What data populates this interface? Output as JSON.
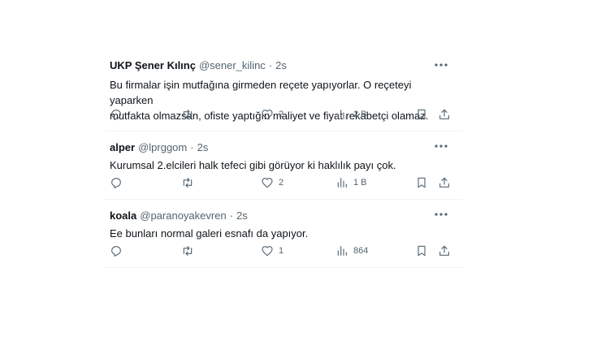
{
  "tweets": [
    {
      "author": "UKP Şener Kılınç",
      "handle": "@sener_kilinc",
      "separator": "·",
      "time": "2s",
      "lines": [
        "Bu firmalar işin mutfağına girmeden reçete yapıyorlar. O reçeteyi yaparken",
        "mutfakta olmazsan, ofiste yaptığın maliyet ve fiyat rekabetçi olamaz."
      ],
      "replies": "",
      "retweets": "",
      "likes": "2",
      "views": "2 B"
    },
    {
      "author": "alper",
      "handle": "@lprggom",
      "separator": "·",
      "time": "2s",
      "lines": [
        "Kurumsal 2.elcileri halk tefeci gibi görüyor ki haklılık payı çok."
      ],
      "replies": "",
      "retweets": "",
      "likes": "2",
      "views": "1 B"
    },
    {
      "author": "koala",
      "handle": "@paranoyakevren",
      "separator": "·",
      "time": "2s",
      "lines": [
        "Ee bunları normal galeri esnafı da yapıyor."
      ],
      "replies": "",
      "retweets": "",
      "likes": "1",
      "views": "864"
    }
  ],
  "icons": {
    "more": "more-dots-icon",
    "reply": "reply-bubble-icon",
    "retweet": "retweet-arrows-icon",
    "like": "heart-icon",
    "views": "analytics-bars-icon",
    "bookmark": "bookmark-icon",
    "share": "share-upload-icon"
  },
  "colors": {
    "text": "#0f1419",
    "secondary": "#536471",
    "divider": "#eff3f4"
  }
}
